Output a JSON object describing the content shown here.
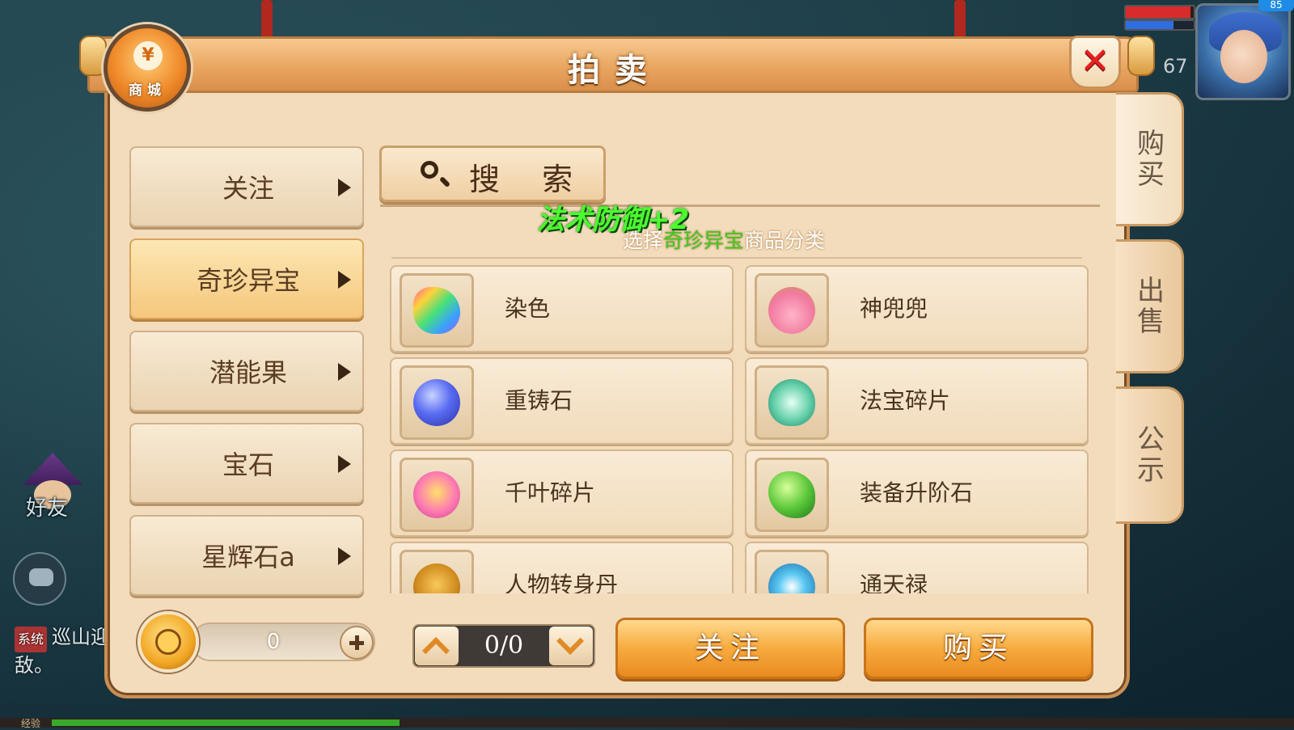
{
  "window": {
    "title": "拍卖",
    "shop_badge_label": "商城",
    "shop_badge_symbol": "¥",
    "close_label": "✕"
  },
  "hud": {
    "level": "67",
    "top_badge": "85",
    "hp_fraction": 0.95,
    "mp_fraction": 0.7,
    "friend_label": "好友",
    "system_tag": "系统",
    "system_message": "巡山迎敌。",
    "exp_label": "经验",
    "exp_fraction": 0.28
  },
  "side_tabs": [
    {
      "label": "购买",
      "active": true
    },
    {
      "label": "出售",
      "active": false
    },
    {
      "label": "公示",
      "active": false
    }
  ],
  "categories": [
    {
      "label": "关注",
      "active": false
    },
    {
      "label": "奇珍异宝",
      "active": true
    },
    {
      "label": "潜能果",
      "active": false
    },
    {
      "label": "宝石",
      "active": false
    },
    {
      "label": "星辉石a",
      "active": false
    }
  ],
  "search": {
    "label": "搜 索"
  },
  "floating_text": "法术防御+2",
  "hint": {
    "prefix": "选择",
    "highlight": "奇珍异宝",
    "suffix": "商品分类"
  },
  "items": [
    {
      "name": "染色",
      "icon": "dye-gem-icon"
    },
    {
      "name": "神兜兜",
      "icon": "pig-doll-icon"
    },
    {
      "name": "重铸石",
      "icon": "blue-orb-icon"
    },
    {
      "name": "法宝碎片",
      "icon": "treasure-shard-icon"
    },
    {
      "name": "千叶碎片",
      "icon": "candy-lollipop-icon"
    },
    {
      "name": "装备升阶石",
      "icon": "green-gem-icon"
    },
    {
      "name": "人物转身丹",
      "icon": "golden-pine-icon"
    },
    {
      "name": "通天禄",
      "icon": "bagua-icon"
    }
  ],
  "footer": {
    "money_value": "0",
    "pager_text": "0/0",
    "follow_label": "关注",
    "buy_label": "购买"
  },
  "colors": {
    "panel": "#f3dcbc",
    "accent_orange": "#f7ab3e",
    "highlight_green": "#3ec81e",
    "close_red": "#e42222"
  }
}
